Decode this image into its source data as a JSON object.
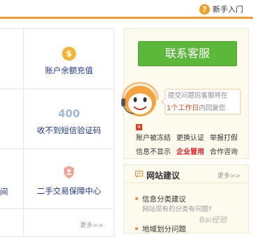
{
  "header": {
    "newbie_label": "新手入门",
    "accent_color": "#f39a2c"
  },
  "services": [
    {
      "label": "账户余额充值",
      "icon": "coin-icon",
      "glyph": "$"
    },
    {
      "label": "收不到短信验证码",
      "icon": "sms-400-icon",
      "glyph": "400"
    },
    {
      "label": "二手交易保障中心",
      "icon": "shield-icon"
    }
  ],
  "left_partial": {
    "cut_label": "间"
  },
  "left_more": "更多>>",
  "contact": {
    "button_label": "联系客服",
    "bubble_line1": "提交问题后客服将在",
    "bubble_highlight": "1个工作日",
    "bubble_line2_rest": "内回复您",
    "button_color": "#5bb83b"
  },
  "quick_links": {
    "new_tag": "N",
    "row1": [
      "账户被冻结",
      "更换认证",
      "举报打假"
    ],
    "row2": [
      "信息不显示",
      "企业冒用",
      "合作咨询"
    ]
  },
  "notice": {
    "title": "网站建议",
    "more": "更多>>",
    "items": [
      {
        "title": "信息分类建议",
        "sub": "网站现有的分类有问题?"
      },
      {
        "title": "地域划分问题",
        "sub": ""
      }
    ]
  },
  "watermark": "Bai经验"
}
